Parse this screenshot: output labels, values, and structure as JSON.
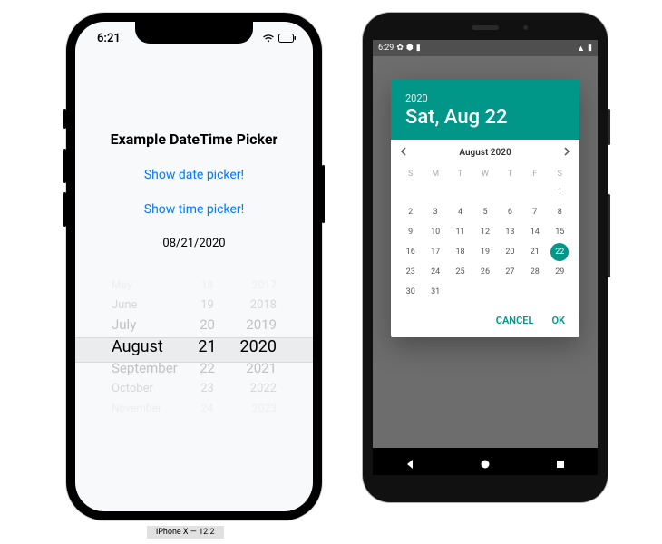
{
  "ios": {
    "status_time": "6:21",
    "title": "Example DateTime Picker",
    "show_date": "Show date picker!",
    "show_time": "Show time picker!",
    "selected": "08/21/2020",
    "wheel": {
      "months": [
        "May",
        "June",
        "July",
        "August",
        "September",
        "October",
        "November"
      ],
      "days": [
        "18",
        "19",
        "20",
        "21",
        "22",
        "23",
        "24"
      ],
      "years": [
        "2017",
        "2018",
        "2019",
        "2020",
        "2021",
        "2022",
        "2023"
      ]
    },
    "caption": "iPhone X — 12.2"
  },
  "android": {
    "status_time": "6:29",
    "header_year": "2020",
    "header_date": "Sat, Aug 22",
    "month_label": "August 2020",
    "weekdays": [
      "S",
      "M",
      "T",
      "W",
      "T",
      "F",
      "S"
    ],
    "grid": [
      [
        "",
        "",
        "",
        "",
        "",
        "",
        "1"
      ],
      [
        "2",
        "3",
        "4",
        "5",
        "6",
        "7",
        "8"
      ],
      [
        "9",
        "10",
        "11",
        "12",
        "13",
        "14",
        "15"
      ],
      [
        "16",
        "17",
        "18",
        "19",
        "20",
        "21",
        "22"
      ],
      [
        "23",
        "24",
        "25",
        "26",
        "27",
        "28",
        "29"
      ],
      [
        "30",
        "31",
        "",
        "",
        "",
        "",
        ""
      ]
    ],
    "selected_day": "22",
    "cancel": "CANCEL",
    "ok": "OK"
  }
}
